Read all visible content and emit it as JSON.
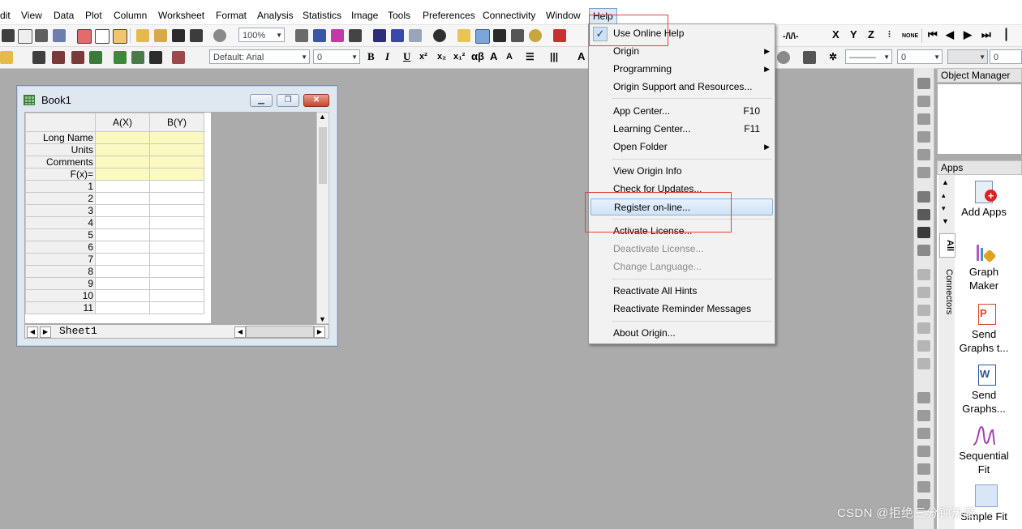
{
  "menubar": {
    "items": [
      "dit",
      "View",
      "Data",
      "Plot",
      "Column",
      "Worksheet",
      "Format",
      "Analysis",
      "Statistics",
      "Image",
      "Tools",
      "Preferences",
      "Connectivity",
      "Window",
      "Help"
    ]
  },
  "toolbar": {
    "zoom": "100%",
    "font": "Default: Arial",
    "font_size": "0",
    "style_buttons": [
      "B",
      "I",
      "U",
      "x²",
      "x₂",
      "x₁²",
      "αβ",
      "A",
      "A"
    ],
    "right_glyphs": [
      "X",
      "Y",
      "Z"
    ],
    "none_label": "NONE",
    "right_combo_1": "0",
    "right_combo_2": "0"
  },
  "book1": {
    "title": "Book1",
    "columns": [
      "A(X)",
      "B(Y)"
    ],
    "meta_rows": [
      "Long Name",
      "Units",
      "Comments",
      "F(x)="
    ],
    "rows": [
      "1",
      "2",
      "3",
      "4",
      "5",
      "6",
      "7",
      "8",
      "9",
      "10",
      "11"
    ],
    "sheet_tab": "Sheet1"
  },
  "help_menu": {
    "items": [
      {
        "label": "Use Online Help",
        "checked": true
      },
      {
        "label": "Origin",
        "submenu": true
      },
      {
        "label": "Programming",
        "submenu": true
      },
      {
        "label": "Origin Support and Resources..."
      },
      {
        "label": "App Center...",
        "accel": "F10"
      },
      {
        "label": "Learning Center...",
        "accel": "F11"
      },
      {
        "label": "Open Folder",
        "submenu": true
      },
      {
        "label": "View Origin Info"
      },
      {
        "label": "Check for Updates..."
      },
      {
        "label": "Register on-line...",
        "highlighted": true
      },
      {
        "label": "Activate License..."
      },
      {
        "label": "Deactivate License...",
        "disabled": true
      },
      {
        "label": "Change Language...",
        "disabled": true
      },
      {
        "label": "Reactivate All Hints"
      },
      {
        "label": "Reactivate Reminder Messages"
      },
      {
        "label": "About Origin..."
      }
    ]
  },
  "object_manager": {
    "title": "Object Manager"
  },
  "apps_panel": {
    "title": "Apps",
    "tabs": [
      "All",
      "Connectors"
    ],
    "apps": [
      {
        "label": "Add Apps",
        "icon": "add-apps-icon"
      },
      {
        "label": "Graph Maker",
        "icon": "graph-maker-icon"
      },
      {
        "label": "Send Graphs t...",
        "icon": "send-graphs-ppt-icon"
      },
      {
        "label": "Send Graphs...",
        "icon": "send-graphs-word-icon"
      },
      {
        "label": "Sequential Fit",
        "icon": "sequential-fit-icon"
      },
      {
        "label": "Simple Fit",
        "icon": "simple-fit-icon"
      }
    ]
  },
  "watermark": "CSDN @拒绝三分钟热度",
  "colors": {
    "workspace": "#ababab",
    "menu_highlight": "#cfe2f7",
    "annotation_red": "#e24040",
    "column_yellow": "#fafac0"
  }
}
